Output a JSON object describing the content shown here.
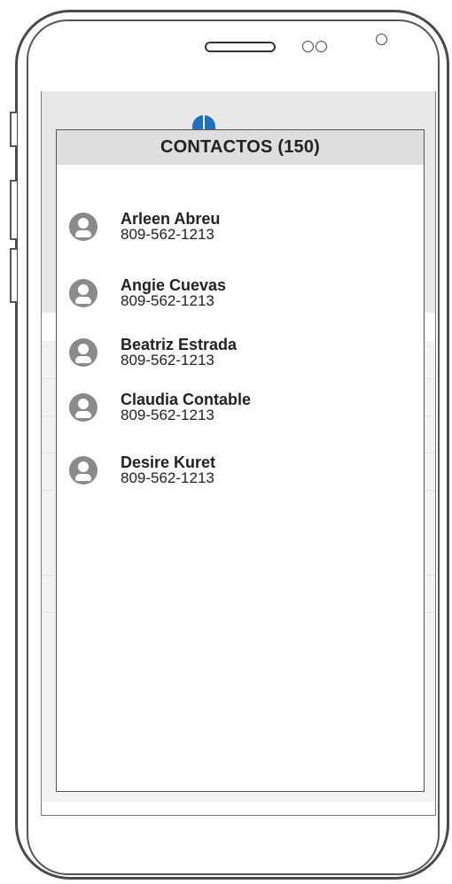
{
  "modal": {
    "title": "CONTACTOS (150)"
  },
  "contacts": [
    {
      "name": "Arleen Abreu",
      "phone": "809-562-1213"
    },
    {
      "name": "Angie Cuevas",
      "phone": "809-562-1213"
    },
    {
      "name": "Beatriz Estrada",
      "phone": "809-562-1213"
    },
    {
      "name": "Claudia Contable",
      "phone": "809-562-1213"
    },
    {
      "name": "Desire Kuret",
      "phone": "809-562-1213"
    }
  ],
  "icons": {
    "avatar": "user-avatar-icon",
    "app_logo": "umbrella-logo-icon"
  },
  "colors": {
    "header_bg": "#dedede",
    "avatar": "#8a8a8a",
    "logo": "#1d6fc0"
  }
}
